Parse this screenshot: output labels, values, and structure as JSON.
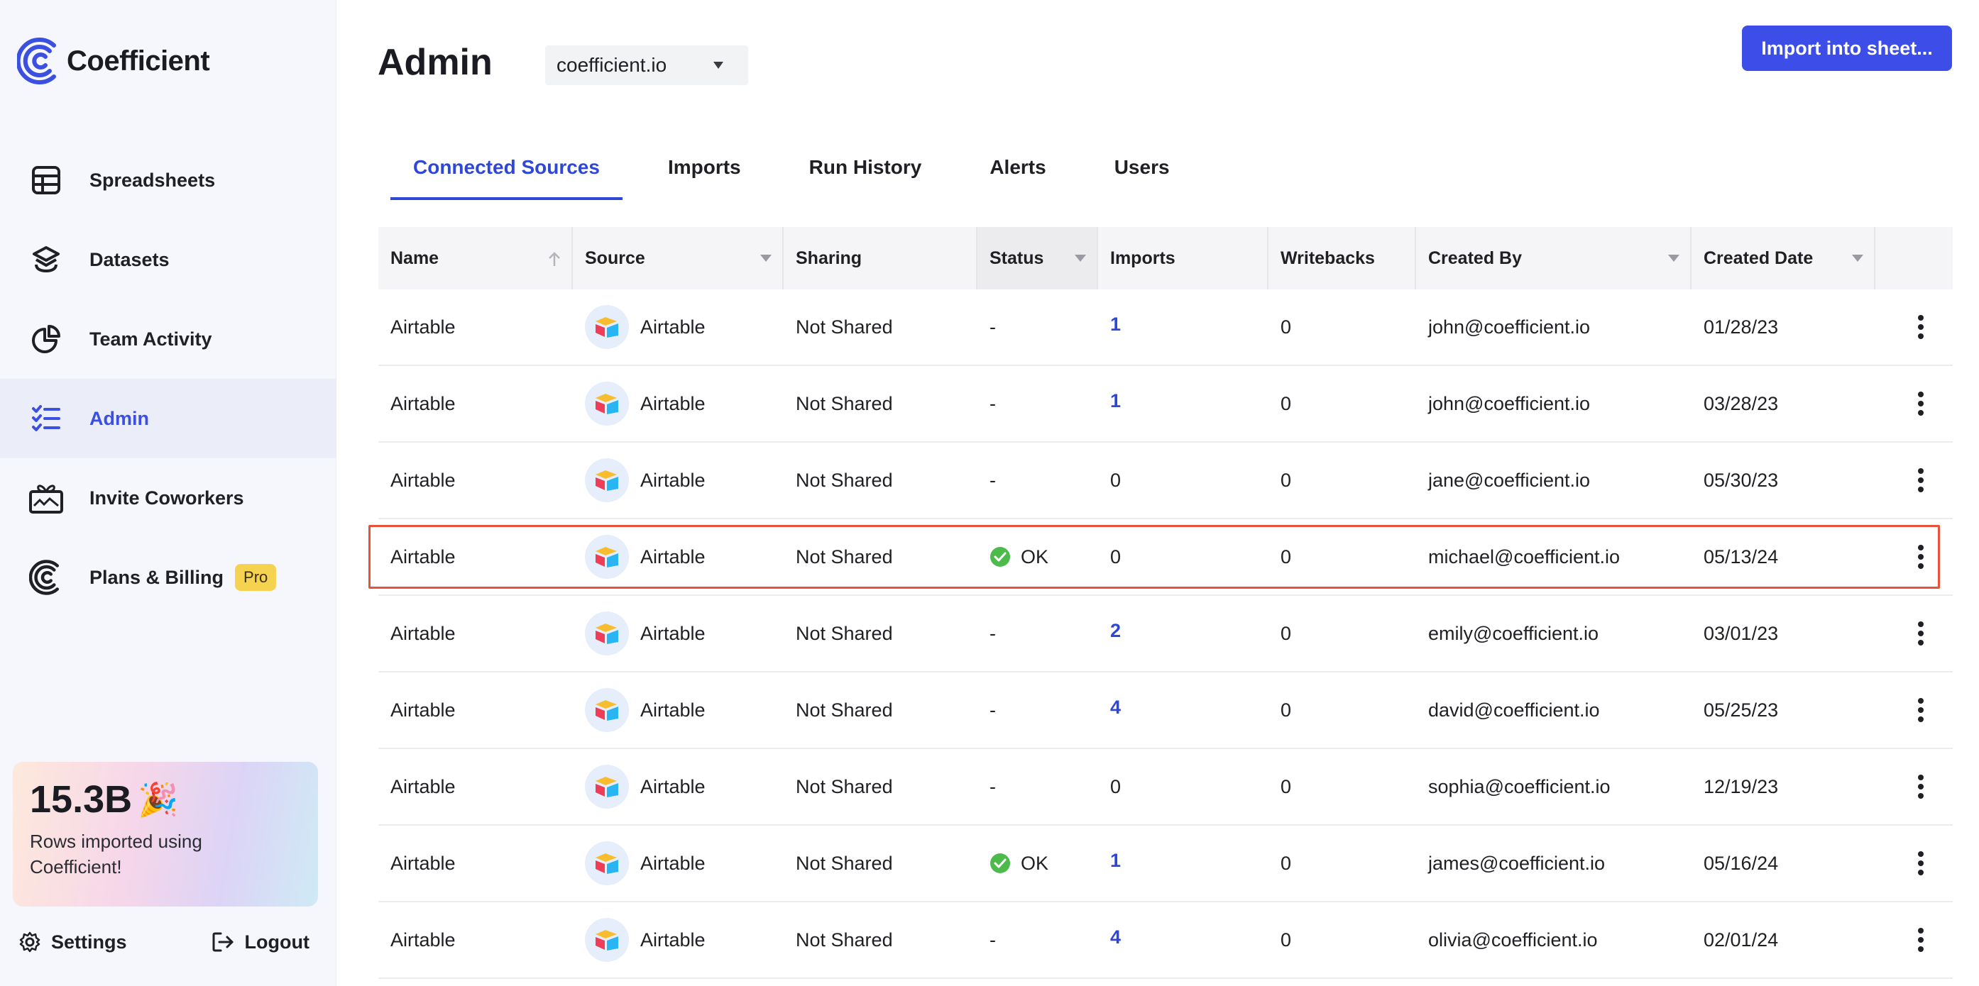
{
  "app": {
    "name": "Coefficient"
  },
  "sidebar": {
    "items": [
      {
        "label": "Spreadsheets",
        "icon": "table-grid-icon"
      },
      {
        "label": "Datasets",
        "icon": "layers-icon"
      },
      {
        "label": "Team Activity",
        "icon": "pie-chart-icon"
      },
      {
        "label": "Admin",
        "icon": "checklist-icon",
        "active": true
      },
      {
        "label": "Invite Coworkers",
        "icon": "gift-icon"
      },
      {
        "label": "Plans & Billing",
        "icon": "coefficient-logo-icon",
        "badge": "Pro"
      }
    ],
    "promo": {
      "number": "15.3B",
      "emoji": "🎉",
      "text": "Rows imported using Coefficient!"
    },
    "settings_label": "Settings",
    "logout_label": "Logout"
  },
  "header": {
    "title": "Admin",
    "domain_select": "coefficient.io",
    "import_button": "Import into sheet..."
  },
  "tabs": [
    {
      "label": "Connected Sources",
      "active": true
    },
    {
      "label": "Imports"
    },
    {
      "label": "Run History"
    },
    {
      "label": "Alerts"
    },
    {
      "label": "Users"
    }
  ],
  "table": {
    "columns": [
      "Name",
      "Source",
      "Sharing",
      "Status",
      "Imports",
      "Writebacks",
      "Created By",
      "Created Date"
    ],
    "rows": [
      {
        "name": "Airtable",
        "source": "Airtable",
        "sharing": "Not Shared",
        "status": "-",
        "imports": "1",
        "writebacks": "0",
        "created_by": "john@coefficient.io",
        "created_date": "01/28/23"
      },
      {
        "name": "Airtable",
        "source": "Airtable",
        "sharing": "Not Shared",
        "status": "-",
        "imports": "1",
        "writebacks": "0",
        "created_by": "john@coefficient.io",
        "created_date": "03/28/23"
      },
      {
        "name": "Airtable",
        "source": "Airtable",
        "sharing": "Not Shared",
        "status": "-",
        "imports": "0",
        "writebacks": "0",
        "created_by": "jane@coefficient.io",
        "created_date": "05/30/23"
      },
      {
        "name": "Airtable",
        "source": "Airtable",
        "sharing": "Not Shared",
        "status": "OK",
        "imports": "0",
        "writebacks": "0",
        "created_by": "michael@coefficient.io",
        "created_date": "05/13/24",
        "highlighted": true
      },
      {
        "name": "Airtable",
        "source": "Airtable",
        "sharing": "Not Shared",
        "status": "-",
        "imports": "2",
        "writebacks": "0",
        "created_by": "emily@coefficient.io",
        "created_date": "03/01/23"
      },
      {
        "name": "Airtable",
        "source": "Airtable",
        "sharing": "Not Shared",
        "status": "-",
        "imports": "4",
        "writebacks": "0",
        "created_by": "david@coefficient.io",
        "created_date": "05/25/23"
      },
      {
        "name": "Airtable",
        "source": "Airtable",
        "sharing": "Not Shared",
        "status": "-",
        "imports": "0",
        "writebacks": "0",
        "created_by": "sophia@coefficient.io",
        "created_date": "12/19/23"
      },
      {
        "name": "Airtable",
        "source": "Airtable",
        "sharing": "Not Shared",
        "status": "OK",
        "imports": "1",
        "writebacks": "0",
        "created_by": "james@coefficient.io",
        "created_date": "05/16/24"
      },
      {
        "name": "Airtable",
        "source": "Airtable",
        "sharing": "Not Shared",
        "status": "-",
        "imports": "4",
        "writebacks": "0",
        "created_by": "olivia@coefficient.io",
        "created_date": "02/01/24"
      }
    ]
  },
  "colors": {
    "accent": "#3c4de8",
    "active_tab": "#2f47d6",
    "highlight_border": "#e5533a",
    "ok_green": "#4cbb4c",
    "badge": "#f6d251"
  }
}
